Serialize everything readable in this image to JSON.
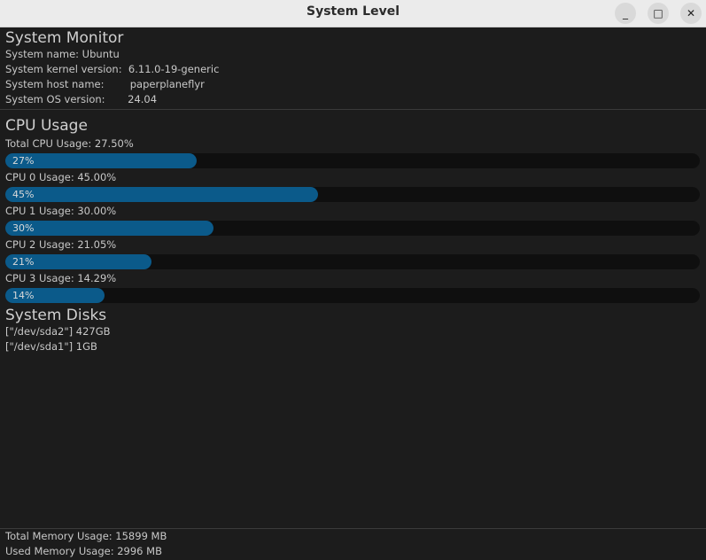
{
  "window": {
    "title": "System Level",
    "buttons": {
      "minimize": "_",
      "maximize": "□",
      "close": "✕"
    }
  },
  "system": {
    "heading": "System Monitor",
    "name": "System name: Ubuntu",
    "kernel": "System kernel version:  6.11.0-19-generic",
    "host": "System host name:        paperplaneflyr",
    "os": "System OS version:       24.04"
  },
  "cpu": {
    "heading": "CPU Usage",
    "total_label": "Total CPU Usage: 27.50%",
    "bars": [
      {
        "percent_label": "27%",
        "fraction": 0.275
      },
      {
        "label": "CPU 0 Usage: 45.00%",
        "percent_label": "45%",
        "fraction": 0.45
      },
      {
        "label": "CPU 1 Usage: 30.00%",
        "percent_label": "30%",
        "fraction": 0.3
      },
      {
        "label": "CPU 2 Usage: 21.05%",
        "percent_label": "21%",
        "fraction": 0.2105
      },
      {
        "label": "CPU 3 Usage: 14.29%",
        "percent_label": "14%",
        "fraction": 0.1429
      }
    ]
  },
  "disks": {
    "heading": "System Disks",
    "items": [
      "[\"/dev/sda2\"] 427GB",
      "[\"/dev/sda1\"] 1GB"
    ]
  },
  "memory": {
    "total": "Total Memory Usage: 15899 MB",
    "used": "Used Memory Usage: 2996 MB"
  },
  "colors": {
    "bar_fill": "#0b5a8a",
    "bar_track": "#0f0f0f",
    "background": "#1c1c1c"
  }
}
